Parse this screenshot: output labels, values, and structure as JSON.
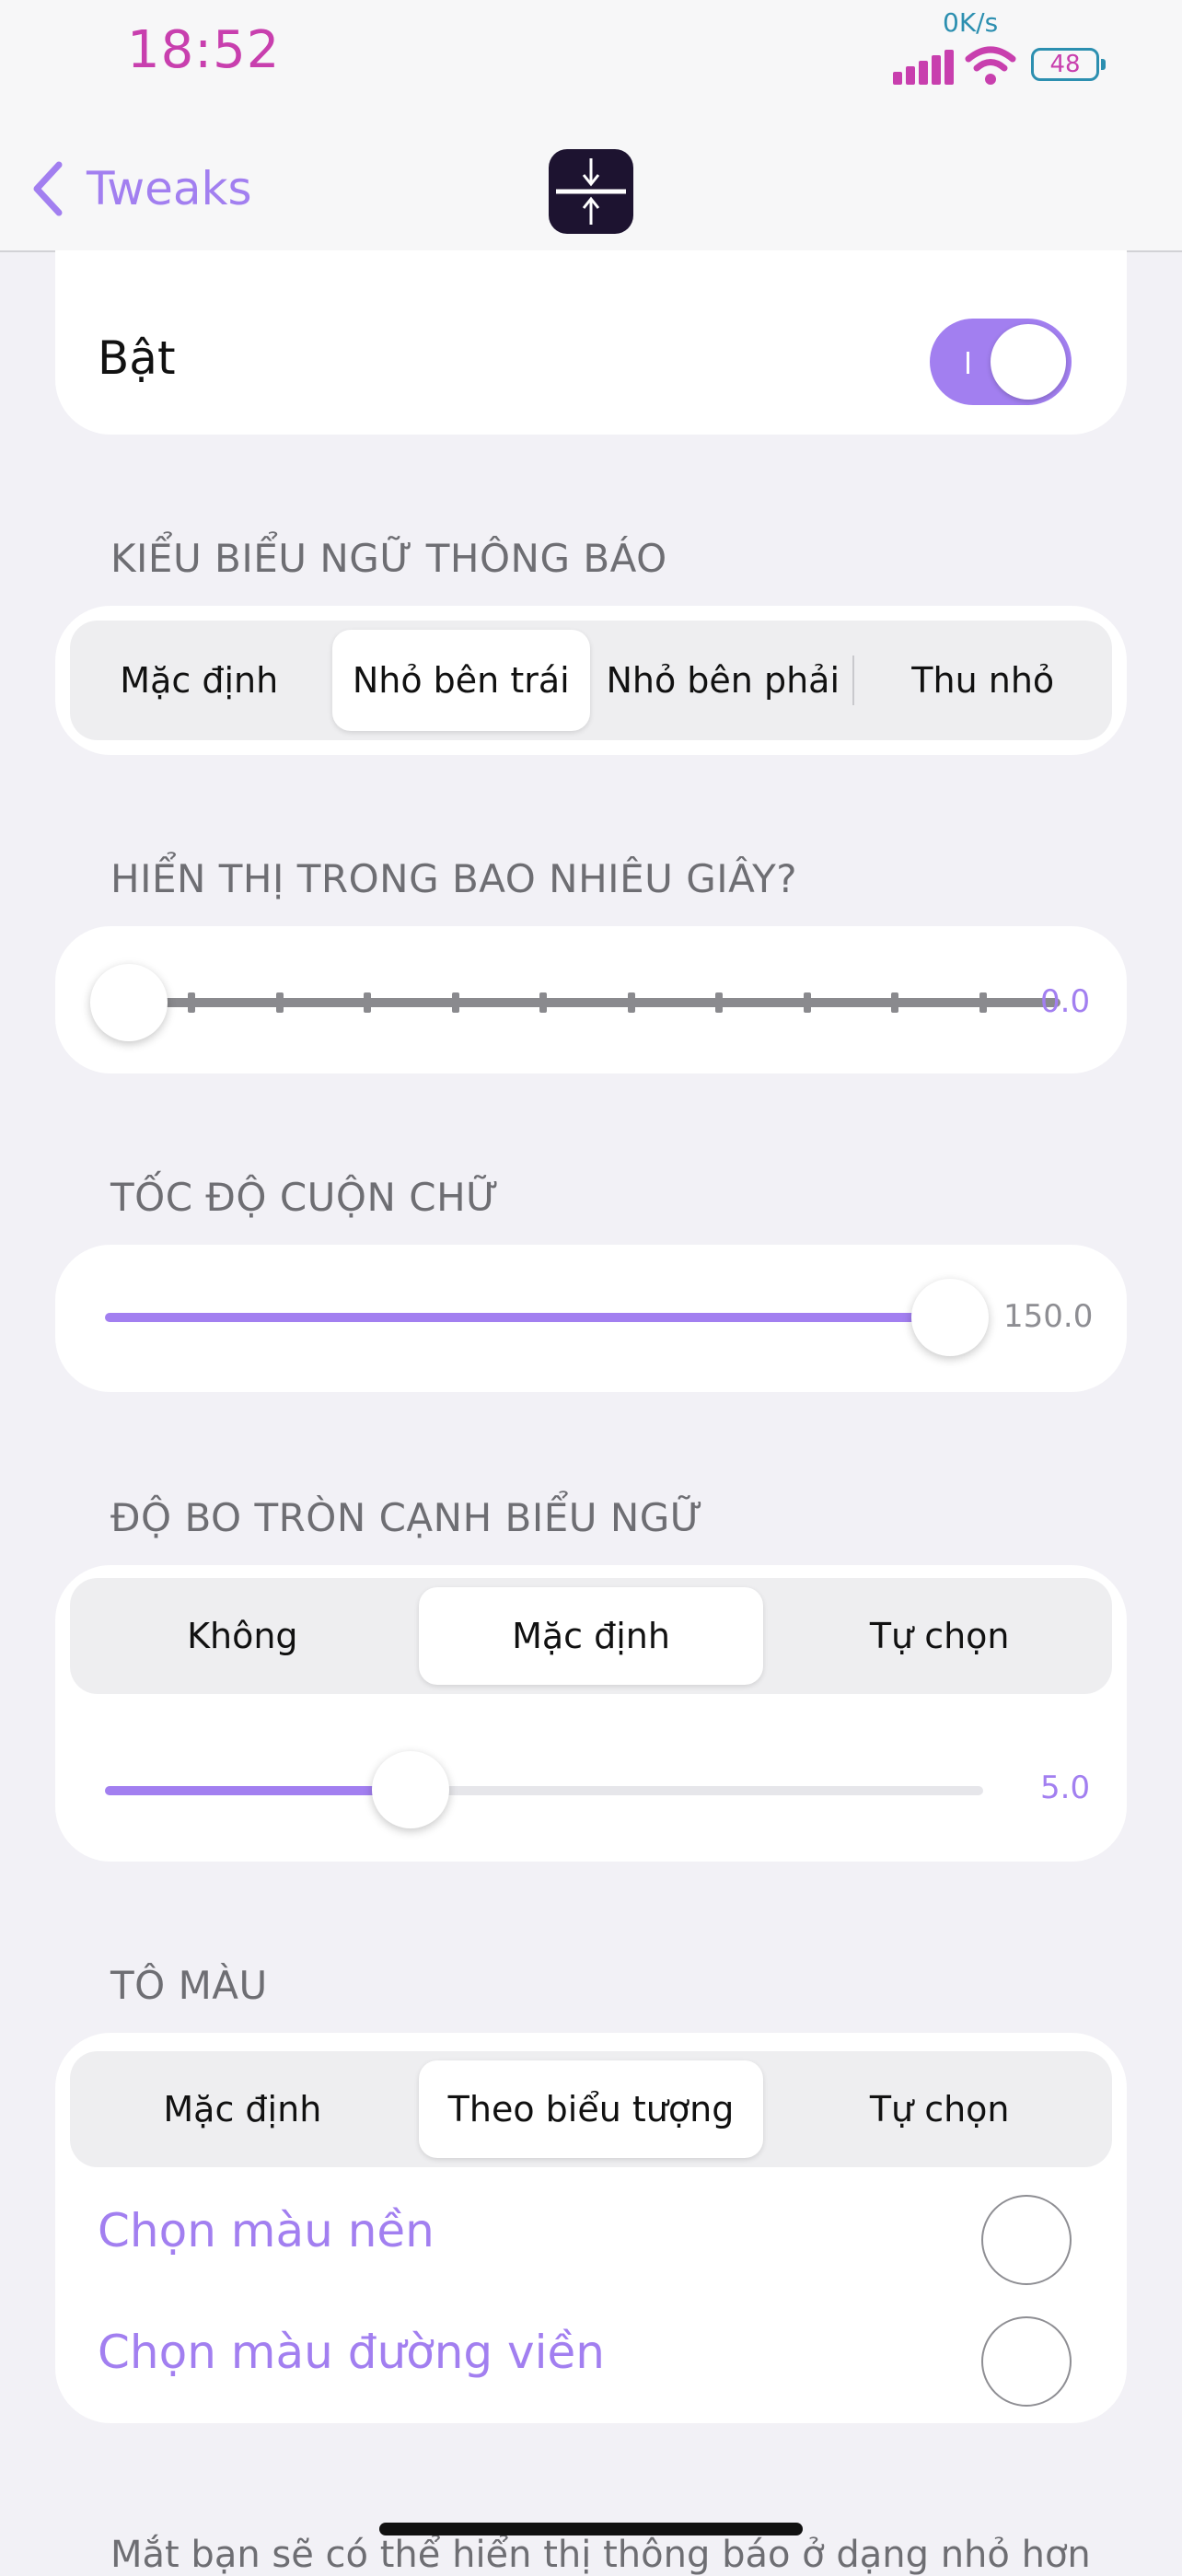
{
  "status_bar": {
    "time": "18:52",
    "network_speed": "0K/s",
    "battery": "48",
    "icons": [
      "signal-icon",
      "wifi-icon",
      "battery-icon"
    ]
  },
  "nav": {
    "back_label": "Tweaks",
    "back_icon": "chevron-left-icon",
    "app_icon": "compress-vertical-icon"
  },
  "enable": {
    "label": "Bật",
    "on": true
  },
  "banner_style": {
    "title": "KIỂU BIỂU NGỮ THÔNG BÁO",
    "options": [
      "Mặc định",
      "Nhỏ bên trái",
      "Nhỏ bên phải",
      "Thu nhỏ"
    ],
    "selected": "Nhỏ bên trái"
  },
  "display_seconds": {
    "title": "HIỂN THỊ TRONG BAO NHIÊU GIÂY?",
    "value": "0.0",
    "fraction": 0
  },
  "scroll_speed": {
    "title": "TỐC ĐỘ CUỘN CHỮ",
    "value": "150.0",
    "fraction": 1
  },
  "corner_radius": {
    "title": "ĐỘ BO TRÒN CẠNH BIỂU NGỮ",
    "options": [
      "Không",
      "Mặc định",
      "Tự chọn"
    ],
    "selected": "Mặc định",
    "value": "5.0",
    "fraction": 0.35
  },
  "tint": {
    "title": "TÔ MÀU",
    "options": [
      "Mặc định",
      "Theo biểu tượng",
      "Tự chọn"
    ],
    "selected": "Theo biểu tượng",
    "background_label": "Chọn màu nền",
    "border_label": "Chọn màu đường viền"
  },
  "colors": {
    "accent": "#a27ff0",
    "time": "#c83fae",
    "network": "#2c8fb0",
    "background": "#f2f1f6"
  },
  "footer_text": "Mắt bạn sẽ có thể hiển thị thông báo ở dạng nhỏ hơn"
}
